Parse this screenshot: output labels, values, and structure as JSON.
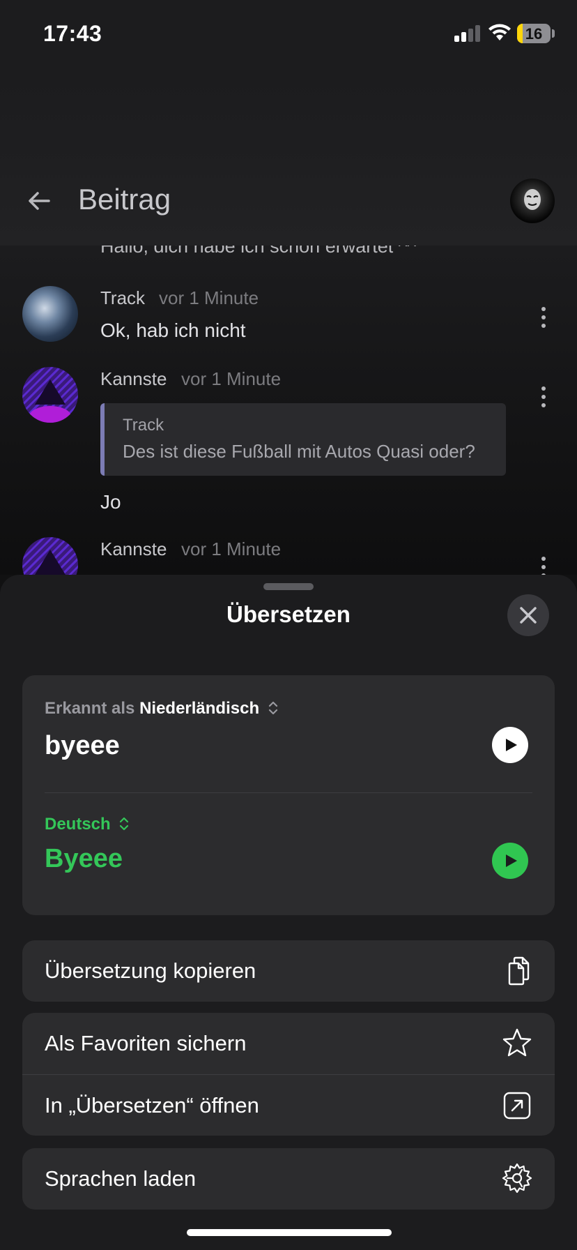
{
  "status_bar": {
    "time": "17:43",
    "battery": "16",
    "battery_level": 0.16
  },
  "header": {
    "title": "Beitrag",
    "back_icon": "arrow-left-icon",
    "avatar_icon": "profile-avatar"
  },
  "chat": {
    "partial_message": "Hallo, dich habe ich schon erwartet ^^",
    "messages": [
      {
        "author": "Track",
        "time": "vor 1 Minute",
        "text": "Ok, hab ich nicht"
      },
      {
        "author": "Kannste",
        "time": "vor 1 Minute",
        "quote_author": "Track",
        "quote_text": "Des ist diese Fußball mit Autos Quasi oder?",
        "text": "Jo"
      },
      {
        "author": "Kannste",
        "time": "vor 1 Minute"
      }
    ]
  },
  "sheet": {
    "title": "Übersetzen",
    "close_icon": "close-icon",
    "source": {
      "detected_prefix": "Erkannt als",
      "language": "Niederländisch",
      "text": "byeee"
    },
    "target": {
      "language": "Deutsch",
      "text": "Byeee"
    },
    "actions": {
      "copy": {
        "label": "Übersetzung kopieren",
        "icon": "copy-icon"
      },
      "favorite": {
        "label": "Als Favoriten sichern",
        "icon": "star-icon"
      },
      "open_app": {
        "label": "In „Übersetzen“ öffnen",
        "icon": "open-external-icon"
      },
      "languages": {
        "label": "Sprachen laden",
        "icon": "gear-icon"
      }
    }
  },
  "colors": {
    "accent_green": "#34c759",
    "sheet_bg": "#1c1c1e",
    "card_bg": "#2c2c2e"
  }
}
